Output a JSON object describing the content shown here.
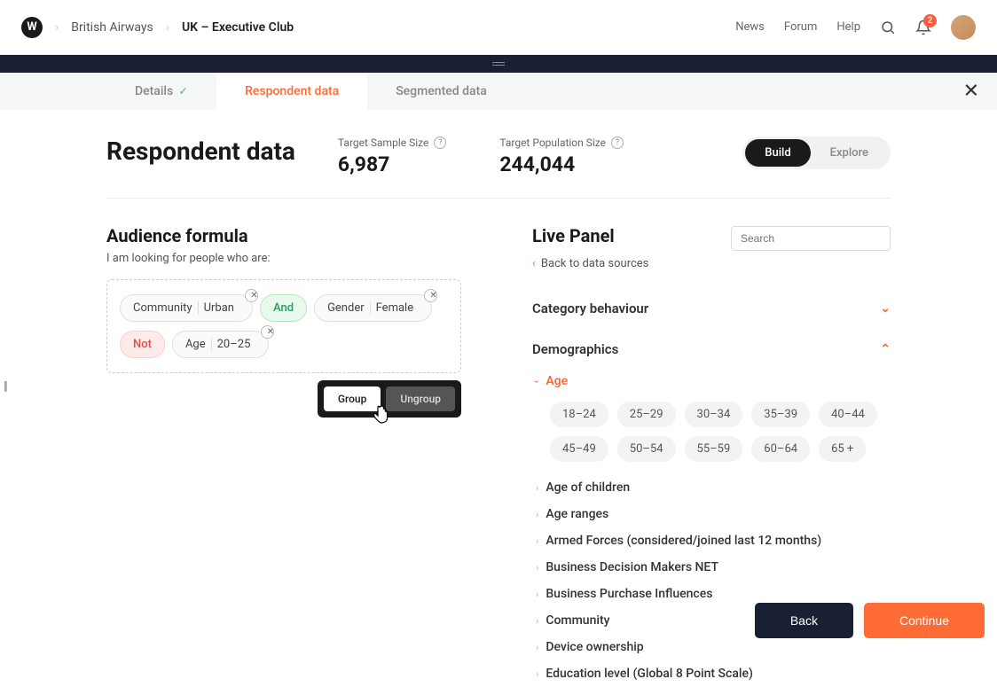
{
  "header": {
    "logo_letter": "W",
    "breadcrumb_1": "British Airways",
    "breadcrumb_2": "UK – Executive Club",
    "links": {
      "news": "News",
      "forum": "Forum",
      "help": "Help"
    },
    "notification_count": "2"
  },
  "tabs": {
    "details": "Details",
    "respondent": "Respondent data",
    "segmented": "Segmented data"
  },
  "page": {
    "title": "Respondent data",
    "sample_label": "Target Sample Size",
    "sample_value": "6,987",
    "population_label": "Target Population Size",
    "population_value": "244,044",
    "toggle_build": "Build",
    "toggle_explore": "Explore"
  },
  "formula": {
    "title": "Audience formula",
    "subtitle": "I am looking for people who are:",
    "pill1a": "Community",
    "pill1b": "Urban",
    "pill_and": "And",
    "pill2a": "Gender",
    "pill2b": "Female",
    "pill_not": "Not",
    "pill3a": "Age",
    "pill3b": "20–25",
    "popover_group": "Group",
    "popover_ungroup": "Ungroup"
  },
  "panel": {
    "title": "Live Panel",
    "search_placeholder": "Search",
    "back_link": "Back to data sources",
    "cat_behaviour": "Category behaviour",
    "cat_demographics": "Demographics",
    "age": "Age",
    "age_chips": [
      "18–24",
      "25–29",
      "30–34",
      "35–39",
      "40–44",
      "45–49",
      "50–54",
      "55–59",
      "60–64",
      "65 +"
    ],
    "sub_items": [
      "Age of children",
      "Age ranges",
      "Armed Forces (considered/joined last 12 months)",
      "Business Decision Makers NET",
      "Business Purchase Influences",
      "Community",
      "Device ownership",
      "Education level (Global 8 Point Scale)"
    ]
  },
  "footer": {
    "back": "Back",
    "continue": "Continue"
  }
}
